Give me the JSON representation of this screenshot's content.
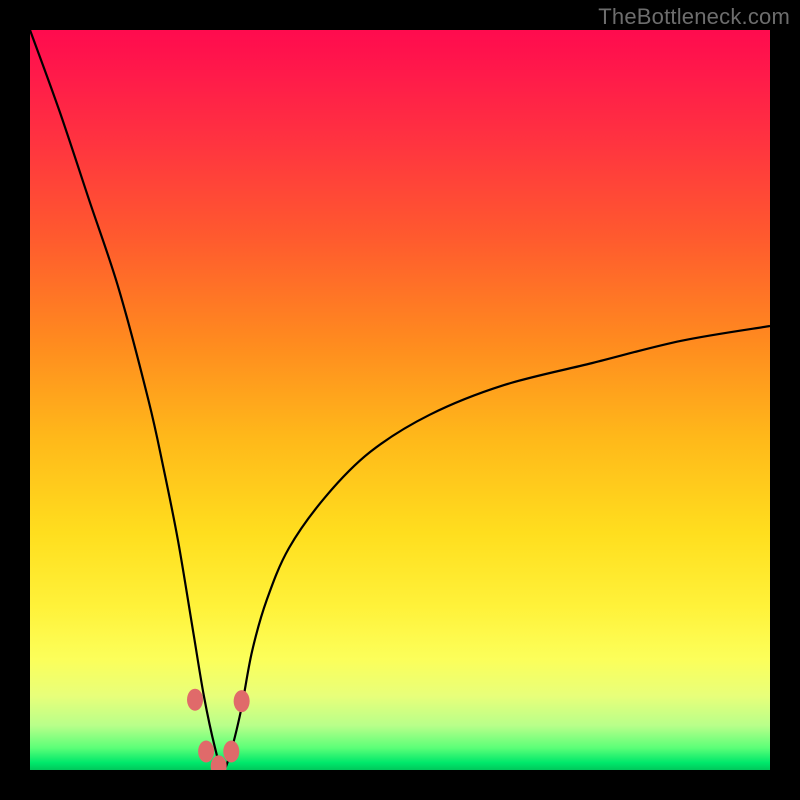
{
  "watermark": "TheBottleneck.com",
  "colors": {
    "frame": "#000000",
    "watermark": "#6d6d6d",
    "curve": "#000000",
    "point": "#e06a6a",
    "gradient_top": "#ff0b4e",
    "gradient_bottom": "#00c85b"
  },
  "chart_data": {
    "type": "line",
    "title": "",
    "xlabel": "",
    "ylabel": "",
    "xlim": [
      0,
      100
    ],
    "ylim": [
      0,
      100
    ],
    "background": "vertical-gradient red→orange→yellow→green",
    "notes": "V-shaped bottleneck curve; minimum around x≈26; right branch asymptotes near y≈60 at x=100",
    "series": [
      {
        "name": "bottleneck-curve",
        "x": [
          0,
          4,
          8,
          12,
          16,
          18,
          20,
          22,
          23.5,
          25,
          26,
          27,
          28.5,
          30,
          32,
          35,
          40,
          46,
          54,
          64,
          76,
          88,
          100
        ],
        "y": [
          100,
          89,
          77,
          65,
          50,
          41,
          31,
          19,
          10,
          3,
          0,
          2,
          8,
          16,
          23,
          30,
          37,
          43,
          48,
          52,
          55,
          58,
          60
        ]
      }
    ],
    "annotations": [
      {
        "name": "min-points-cluster",
        "shape": "rounded-dots",
        "color": "#e06a6a",
        "points": [
          {
            "x": 22.3,
            "y": 9.5
          },
          {
            "x": 23.8,
            "y": 2.5
          },
          {
            "x": 25.5,
            "y": 0.5
          },
          {
            "x": 27.2,
            "y": 2.5
          },
          {
            "x": 28.6,
            "y": 9.3
          }
        ]
      }
    ]
  }
}
